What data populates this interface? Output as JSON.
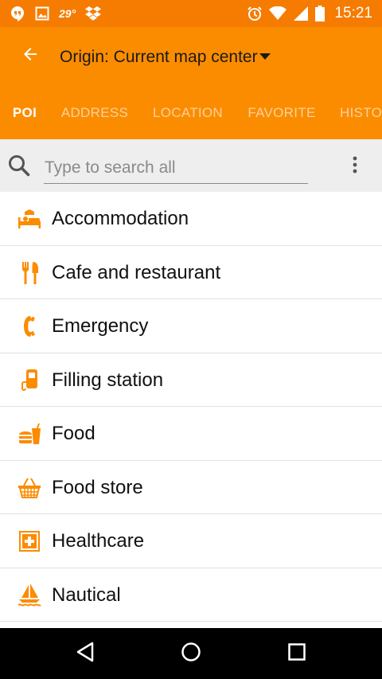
{
  "status_bar": {
    "temperature": "29°",
    "time": "15:21",
    "icons": [
      "hangouts-icon",
      "image-icon",
      "dropbox-icon",
      "alarm-icon",
      "wifi-icon",
      "signal-icon",
      "battery-icon"
    ]
  },
  "toolbar": {
    "back_icon": "arrow-back-icon",
    "origin_label": "Origin: Current map center",
    "origin_dropdown_icon": "caret-down-icon"
  },
  "tabs": [
    {
      "label": "POI",
      "active": true
    },
    {
      "label": "ADDRESS",
      "active": false
    },
    {
      "label": "LOCATION",
      "active": false
    },
    {
      "label": "FAVORITE",
      "active": false
    },
    {
      "label": "HISTO",
      "active": false
    }
  ],
  "search": {
    "placeholder": "Type to search all",
    "value": "",
    "search_icon": "search-icon",
    "menu_icon": "more-vert-icon"
  },
  "categories": [
    {
      "label": "Accommodation",
      "icon": "bed-icon"
    },
    {
      "label": "Cafe and restaurant",
      "icon": "fork-knife-icon"
    },
    {
      "label": "Emergency",
      "icon": "phone-icon"
    },
    {
      "label": "Filling station",
      "icon": "fuel-pump-icon"
    },
    {
      "label": "Food",
      "icon": "fast-food-icon"
    },
    {
      "label": "Food store",
      "icon": "basket-icon"
    },
    {
      "label": "Healthcare",
      "icon": "medical-cross-icon"
    },
    {
      "label": "Nautical",
      "icon": "sailboat-icon"
    }
  ],
  "nav_bar": {
    "buttons": [
      "back-nav-icon",
      "home-nav-icon",
      "recents-nav-icon"
    ]
  },
  "colors": {
    "primary": "#fb8c00",
    "status_bar": "#f57c00",
    "category_icon": "#fb8c00",
    "search_bar_bg": "#eeeeee",
    "nav_bar_bg": "#000000"
  }
}
